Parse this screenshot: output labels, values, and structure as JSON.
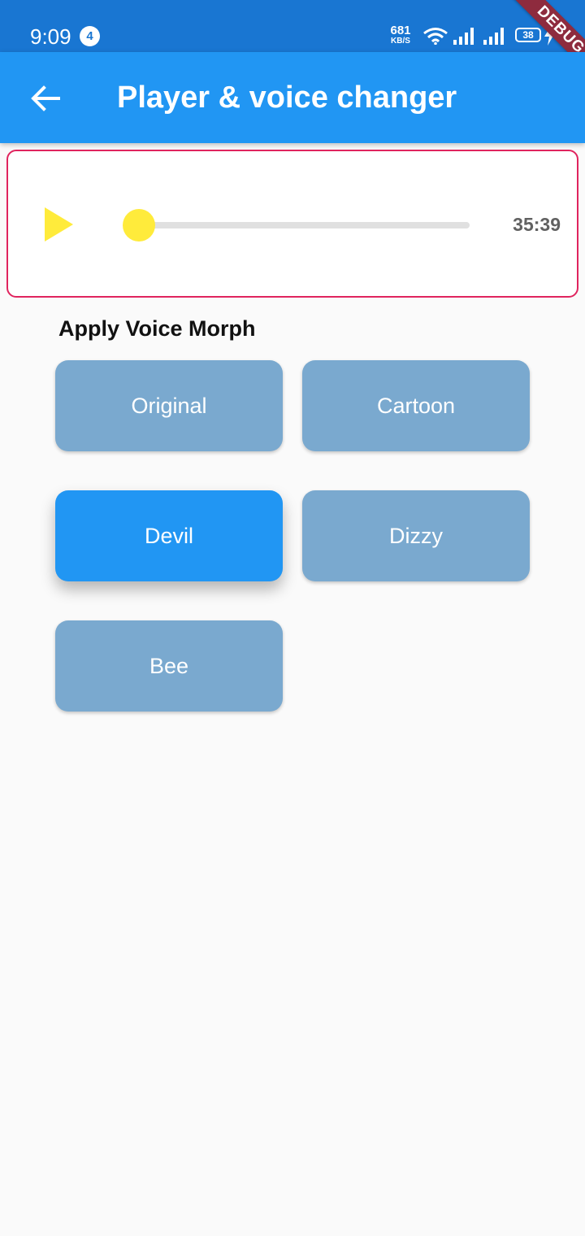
{
  "status_bar": {
    "time": "9:09",
    "notification_count": "4",
    "net_speed_value": "681",
    "net_speed_unit": "KB/S",
    "battery": "38",
    "icons": [
      "wifi-icon",
      "signal-icon",
      "signal-icon",
      "battery-icon",
      "charging-icon"
    ]
  },
  "debug_banner": "DEBUG",
  "app_bar": {
    "title": "Player & voice changer",
    "back_icon": "arrow-back-icon"
  },
  "player": {
    "play_icon": "play-icon",
    "duration": "35:39",
    "progress_fraction": 0.0,
    "accent_color": "#ffeb3b",
    "border_color": "#e0245e"
  },
  "voice_morph": {
    "heading": "Apply Voice Morph",
    "selected": "Devil",
    "buttons": [
      "Original",
      "Cartoon",
      "Devil",
      "Dizzy",
      "Bee"
    ]
  },
  "colors": {
    "primary": "#2196f3",
    "status_bar": "#1976d2",
    "inactive_button": "#7aa9cf"
  }
}
